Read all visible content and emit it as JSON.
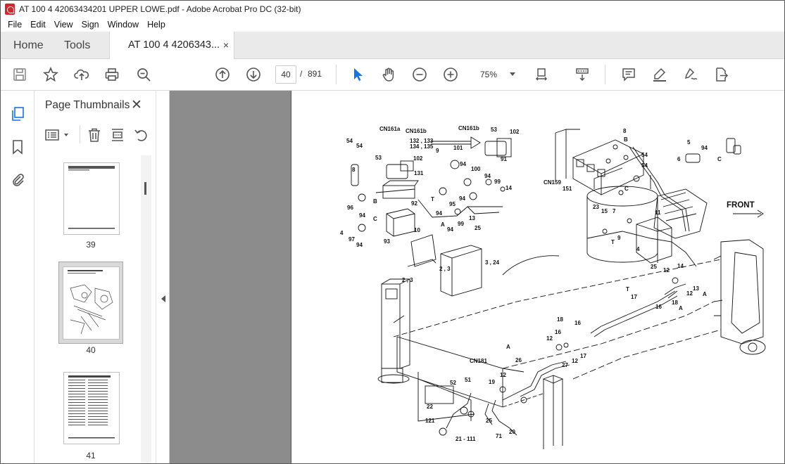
{
  "window": {
    "title": "AT 100 4 42063434201 UPPER LOWE.pdf - Adobe Acrobat Pro DC (32-bit)"
  },
  "menu": [
    "File",
    "Edit",
    "View",
    "Sign",
    "Window",
    "Help"
  ],
  "tabs": {
    "home": "Home",
    "tools": "Tools",
    "document": "AT 100 4 4206343...",
    "close": "×"
  },
  "toolbar": {
    "page_current": "40",
    "page_separator": "/",
    "page_total": "891",
    "zoom": "75%",
    "icons": [
      "save-icon",
      "bookmark-star-icon",
      "upload-icon",
      "print-icon",
      "zoom-search-icon",
      "prev-page-icon",
      "next-page-icon",
      "select-arrow-icon",
      "hand-icon",
      "zoom-out-icon",
      "zoom-in-icon",
      "page-fit-icon",
      "scroll-mode-icon",
      "comment-icon",
      "highlight-icon",
      "sign-icon",
      "export-icon"
    ]
  },
  "sidebar": {
    "title": "Page Thumbnails",
    "close": "✕",
    "thumbnails": [
      {
        "label": "39"
      },
      {
        "label": "40"
      },
      {
        "label": "41"
      }
    ]
  },
  "diagram": {
    "labels": {
      "cn161a": "CN161a",
      "cn161b_top": "CN161b",
      "cn161b_mid": "CN161b",
      "l132_133": "132 , 133",
      "l134_135": "134 , 135",
      "l102_a": "102",
      "l102_b": "102",
      "l53_a": "53",
      "l53_b": "53",
      "l54_a": "54",
      "l54_b": "54",
      "l54_c": "54",
      "l54_d": "54",
      "l131": "131",
      "l8_a": "8",
      "l8_b": "8",
      "l9": "9",
      "l101": "101",
      "l91": "91",
      "l94_a": "94",
      "l94_b": "94",
      "l94_c": "94",
      "l94_d": "94",
      "l94_e": "94",
      "l94_f": "94",
      "l94_g": "94",
      "l94_h": "94",
      "l100": "100",
      "l99_a": "99",
      "l99_b": "99",
      "l14_a": "14",
      "l14_b": "14",
      "l96": "96",
      "l95": "95",
      "l92": "92",
      "l13_a": "13",
      "l13_b": "13",
      "l97": "97",
      "l93": "93",
      "l4_a": "4",
      "l4_b": "4",
      "l10": "10",
      "l25_a": "25",
      "l25_b": "25",
      "l2_3_a": "2 , 3",
      "l2_3_b": "2 , 3",
      "l3_24": "3 , 24",
      "lB_a": "B",
      "lB_b": "B",
      "lC_a": "C",
      "lC_b": "C",
      "lC_c": "C",
      "lT_a": "T",
      "lT_b": "T",
      "lT_c": "T",
      "lA_a": "A",
      "lA_b": "A",
      "lA_c": "A",
      "lA_d": "A",
      "cn159": "CN159",
      "l151": "151",
      "l23": "23",
      "l15": "15",
      "l7": "7",
      "l11": "11",
      "l9b": "9",
      "l5": "5",
      "l6": "6",
      "front": "FRONT",
      "l12_a": "12",
      "l12_b": "12",
      "l12_c": "12",
      "l12_d": "12",
      "l12_e": "12",
      "l17_a": "17",
      "l17_b": "17",
      "l16_a": "16",
      "l16_b": "16",
      "l16_c": "16",
      "l18_a": "18",
      "l18_b": "18",
      "l26": "26",
      "l27": "27",
      "cn181": "CN181",
      "l52": "52",
      "l51": "51",
      "l19": "19",
      "l22": "22",
      "l121": "121",
      "l21_111": "21 - 111",
      "l71": "71",
      "l20": "20",
      "l25c": "25"
    }
  }
}
